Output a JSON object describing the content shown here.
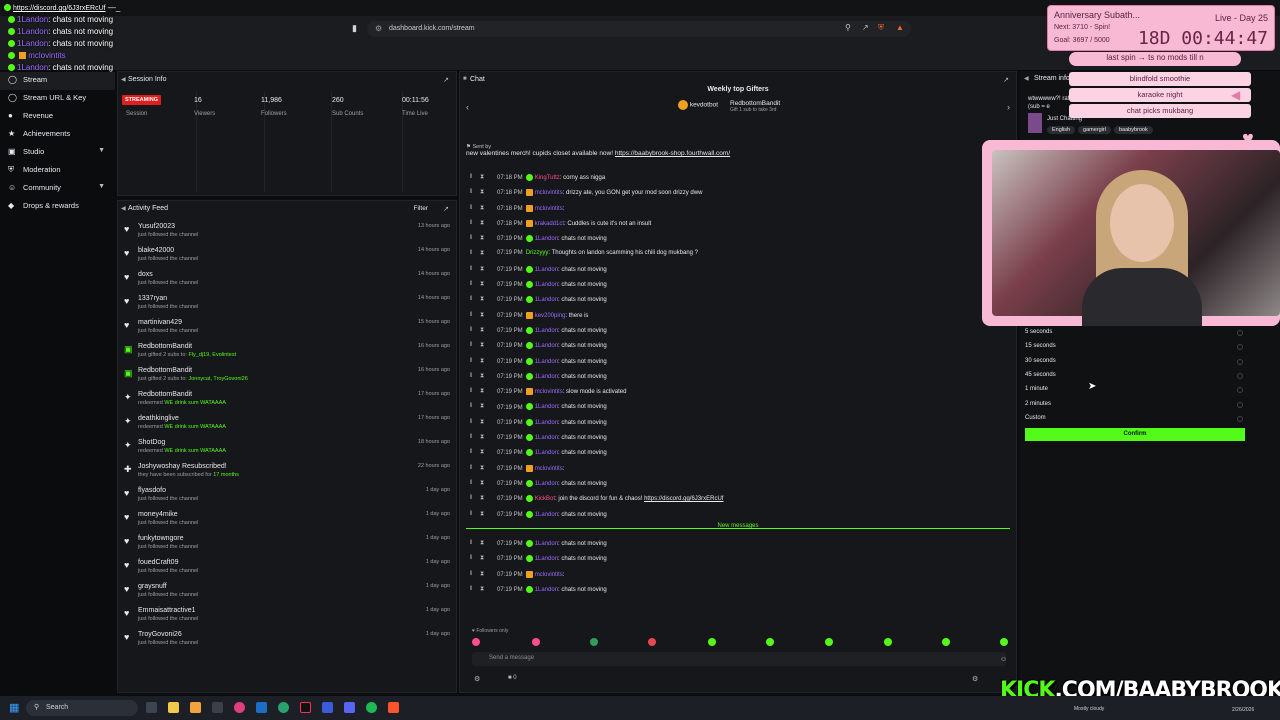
{
  "browser": {
    "url": "dashboard.kick.com/stream"
  },
  "overlay_chat": {
    "link": "https://discord.gg/6J3rxERcUf",
    "lines": [
      {
        "user": "1Landon",
        "msg": "chats not moving"
      },
      {
        "user": "1Landon",
        "msg": "chats not moving"
      },
      {
        "user": "1Landon",
        "msg": "chats not moving"
      },
      {
        "user": "mclovintits",
        "msg": ""
      },
      {
        "user": "1Landon",
        "msg": "chats not moving"
      }
    ]
  },
  "nav": {
    "items": [
      {
        "label": "Stream",
        "icon": "stream-icon",
        "active": true
      },
      {
        "label": "Stream URL & Key",
        "icon": "key-icon"
      },
      {
        "label": "Revenue",
        "icon": "revenue-icon"
      },
      {
        "label": "Achievements",
        "icon": "trophy-icon"
      },
      {
        "label": "Studio",
        "icon": "studio-icon",
        "chevron": true
      },
      {
        "label": "Moderation",
        "icon": "shield-icon"
      },
      {
        "label": "Community",
        "icon": "community-icon",
        "chevron": true
      },
      {
        "label": "Drops & rewards",
        "icon": "gift-icon"
      }
    ]
  },
  "session": {
    "title": "Session Info",
    "badge": "STREAMING",
    "stats": [
      {
        "value": "",
        "label": "Session"
      },
      {
        "value": "16",
        "label": "Viewers"
      },
      {
        "value": "11,986",
        "label": "Followers"
      },
      {
        "value": "260",
        "label": "Sub Counts"
      },
      {
        "value": "00:11:56",
        "label": "Time Live"
      }
    ]
  },
  "feed": {
    "title": "Activity Feed",
    "filter": "Filter",
    "rows": [
      {
        "name": "Yusuf20023",
        "sub": "just followed the channel",
        "time": "13 hours ago",
        "icon": "heart-icon"
      },
      {
        "name": "blake42000",
        "sub": "just followed the channel",
        "time": "14 hours ago",
        "icon": "heart-icon"
      },
      {
        "name": "doxs",
        "sub": "just followed the channel",
        "time": "14 hours ago",
        "icon": "heart-icon"
      },
      {
        "name": "1337ryan",
        "sub": "just followed the channel",
        "time": "14 hours ago",
        "icon": "heart-icon"
      },
      {
        "name": "martinivan429",
        "sub": "just followed the channel",
        "time": "15 hours ago",
        "icon": "heart-icon"
      },
      {
        "name": "RedbottomBandit",
        "sub": "just gifted 2 subs to:",
        "sub_green": "Fly_dj19, Evolintest",
        "time": "16 hours ago",
        "icon": "gift-icon"
      },
      {
        "name": "RedbottomBandit",
        "sub": "just gifted 2 subs to:",
        "sub_green": "Jonnycat, TroyGovoni26",
        "time": "16 hours ago",
        "icon": "gift-icon"
      },
      {
        "name": "RedbottomBandit",
        "sub": "redeemed",
        "sub_green": "WE drink sum WATAAAA",
        "time": "17 hours ago",
        "icon": "reward-icon"
      },
      {
        "name": "deathkinglive",
        "sub": "redeemed",
        "sub_green": "WE drink sum WATAAAA",
        "time": "17 hours ago",
        "icon": "reward-icon"
      },
      {
        "name": "ShotDog",
        "sub": "redeemed",
        "sub_green": "WE drink sum WATAAAA",
        "time": "18 hours ago",
        "icon": "reward-icon"
      },
      {
        "name": "Joshywoshay Resubscribed!",
        "sub": "they have been subscribed for",
        "sub_green": "17 months",
        "time": "22 hours ago",
        "icon": "star-icon"
      },
      {
        "name": "flyasdofo",
        "sub": "just followed the channel",
        "time": "1 day ago",
        "icon": "heart-icon"
      },
      {
        "name": "money4mike",
        "sub": "just followed the channel",
        "time": "1 day ago",
        "icon": "heart-icon"
      },
      {
        "name": "funkytowngore",
        "sub": "just followed the channel",
        "time": "1 day ago",
        "icon": "heart-icon"
      },
      {
        "name": "fouedCraft09",
        "sub": "just followed the channel",
        "time": "1 day ago",
        "icon": "heart-icon"
      },
      {
        "name": "graysnuff",
        "sub": "just followed the channel",
        "time": "1 day ago",
        "icon": "heart-icon"
      },
      {
        "name": "Emmaisattractive1",
        "sub": "just followed the channel",
        "time": "1 day ago",
        "icon": "heart-icon"
      },
      {
        "name": "TroyGovoni26",
        "sub": "just followed the channel",
        "time": "1 day ago",
        "icon": "heart-icon"
      }
    ]
  },
  "chat": {
    "title": "Chat",
    "gifters_title": "Weekly top Gifters",
    "gifter1": {
      "name": "kevdotbot",
      "sub": ""
    },
    "gifter2": {
      "name": "RedbottomBandit",
      "sub": "Gift 1 sub to take 3rd"
    },
    "pinned_by": "Sent by",
    "pinned_msg": "new valentines merch! cupids closet available now!",
    "pinned_link": "https://baabybrook-shop.fourthwall.com/",
    "messages": [
      {
        "time": "07:18 PM",
        "user": "KingTuttz",
        "msg": "corny ass nigga",
        "color": "pink",
        "badge": "green"
      },
      {
        "time": "07:18 PM",
        "user": "mclovintits",
        "msg": "drizzy ate, you GON get your mod soon drizzy dww",
        "color": "",
        "badge": "mod"
      },
      {
        "time": "07:18 PM",
        "user": "mclovintits",
        "msg": "",
        "color": "",
        "badge": "mod"
      },
      {
        "time": "07:18 PM",
        "user": "krakadd1ct",
        "msg": "Cuddles is cute it's not an insult",
        "color": "",
        "badge": "mod"
      },
      {
        "time": "07:19 PM",
        "user": "1Landon",
        "msg": "chats not moving",
        "color": "",
        "badge": "green"
      },
      {
        "time": "07:19 PM",
        "user": "Drizzyyy",
        "msg": "Thoughts on landon scamming his chili dog mukbang ?",
        "color": "green",
        "badge": "none"
      },
      {
        "time": "07:19 PM",
        "user": "1Landon",
        "msg": "chats not moving",
        "color": "",
        "badge": "green"
      },
      {
        "time": "07:19 PM",
        "user": "1Landon",
        "msg": "chats not moving",
        "color": "",
        "badge": "green"
      },
      {
        "time": "07:19 PM",
        "user": "1Landon",
        "msg": "chats not moving",
        "color": "",
        "badge": "green"
      },
      {
        "time": "07:19 PM",
        "user": "kev200ping",
        "msg": "there is",
        "color": "",
        "badge": "mod"
      },
      {
        "time": "07:19 PM",
        "user": "1Landon",
        "msg": "chats not moving",
        "color": "",
        "badge": "green"
      },
      {
        "time": "07:19 PM",
        "user": "1Landon",
        "msg": "chats not moving",
        "color": "",
        "badge": "green"
      },
      {
        "time": "07:19 PM",
        "user": "1Landon",
        "msg": "chats not moving",
        "color": "",
        "badge": "green"
      },
      {
        "time": "07:19 PM",
        "user": "1Landon",
        "msg": "chats not moving",
        "color": "",
        "badge": "green"
      },
      {
        "time": "07:19 PM",
        "user": "mclovintits",
        "msg": "slow mode is activated",
        "color": "",
        "badge": "mod"
      },
      {
        "time": "07:19 PM",
        "user": "1Landon",
        "msg": "chats not moving",
        "color": "",
        "badge": "green"
      },
      {
        "time": "07:19 PM",
        "user": "1Landon",
        "msg": "chats not moving",
        "color": "",
        "badge": "green"
      },
      {
        "time": "07:19 PM",
        "user": "1Landon",
        "msg": "chats not moving",
        "color": "",
        "badge": "green"
      },
      {
        "time": "07:19 PM",
        "user": "1Landon",
        "msg": "chats not moving",
        "color": "",
        "badge": "green"
      },
      {
        "time": "07:19 PM",
        "user": "mclovintits",
        "msg": "",
        "color": "",
        "badge": "mod"
      },
      {
        "time": "07:19 PM",
        "user": "1Landon",
        "msg": "chats not moving",
        "color": "",
        "badge": "green"
      },
      {
        "time": "07:19 PM",
        "user": "KickBot",
        "msg": "join the discord for fun & chaos!",
        "link": "https://discord.gg/6J3rxERcUf",
        "color": "pink",
        "badge": "green"
      },
      {
        "time": "07:19 PM",
        "user": "1Landon",
        "msg": "chats not moving",
        "color": "",
        "badge": "green"
      }
    ],
    "new_messages_label": "New messages",
    "new_messages": [
      {
        "time": "07:19 PM",
        "user": "1Landon",
        "msg": "chats not moving",
        "color": "",
        "badge": "green"
      },
      {
        "time": "07:19 PM",
        "user": "1Landon",
        "msg": "chats not moving",
        "color": "",
        "badge": "green"
      },
      {
        "time": "07:19 PM",
        "user": "mclovintits",
        "msg": "",
        "color": "",
        "badge": "mod"
      },
      {
        "time": "07:19 PM",
        "user": "1Landon",
        "msg": "chats not moving",
        "color": "",
        "badge": "green"
      }
    ],
    "followers_only": "Followers only",
    "input_placeholder": "Send a message",
    "counter": "0"
  },
  "right": {
    "title": "Stream info",
    "stream_title": "wtwwwww?! raffle (sub = e",
    "category": "Just Chatting",
    "tags": [
      "English",
      "gamergirl",
      "baabybrook"
    ],
    "slow_options": [
      "5 seconds",
      "15 seconds",
      "30 seconds",
      "45 seconds",
      "1 minute",
      "2 minutes",
      "Custom"
    ],
    "confirm": "Confirm"
  },
  "stream_overlay": {
    "anniv_title": "Anniversary Subath...",
    "next": "Next: 3710 - Spin!",
    "goal": "Goal: 3697 / 5000",
    "day": "Live - Day 25",
    "countdown": "18D 00:44:47",
    "spin": "last spin → ts no mods till n",
    "items": [
      "blindfold smoothie",
      "karaoke night",
      "chat picks mukbang"
    ],
    "kick_brand": "KICK",
    "kick_rest": ".COM/BAABYBROOK"
  },
  "taskbar": {
    "search": "Search",
    "weather": "Mostly cloudy",
    "date": "2/26/2026"
  }
}
